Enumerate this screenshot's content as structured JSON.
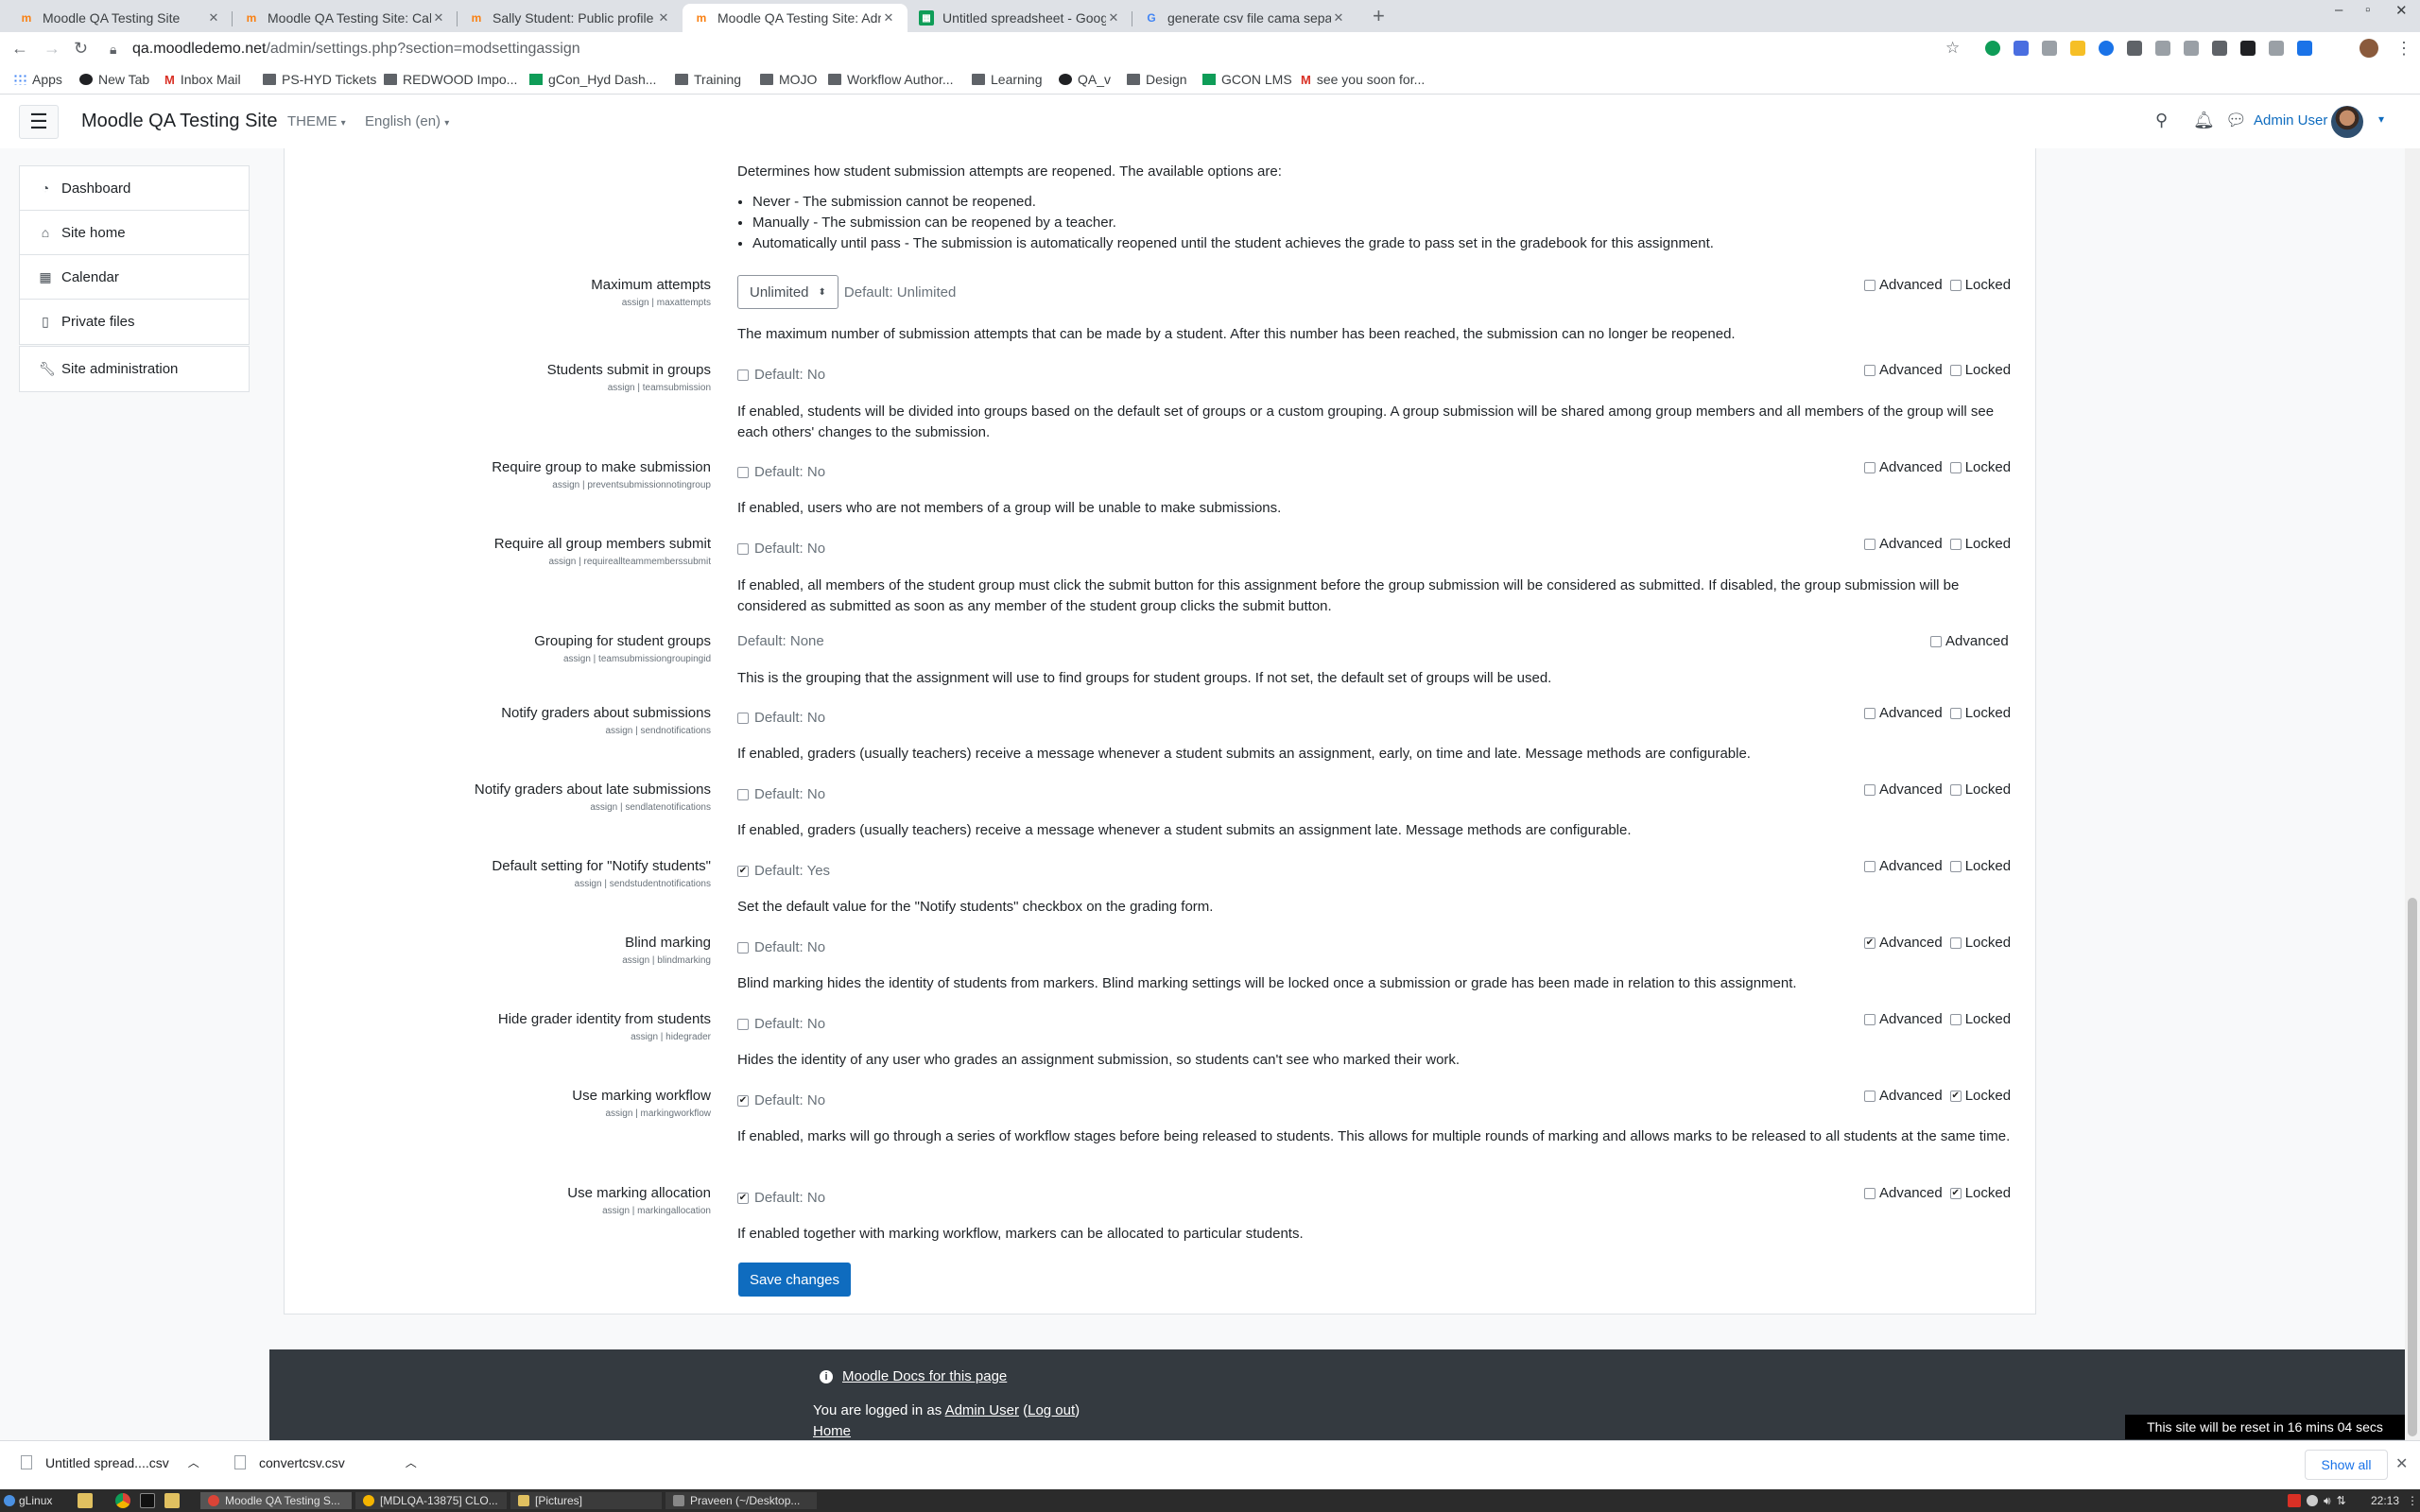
{
  "browser": {
    "tabs": [
      {
        "title": "Moodle QA Testing Site",
        "favicon": "moodle-icon"
      },
      {
        "title": "Moodle QA Testing Site: Calendar",
        "favicon": "moodle-icon"
      },
      {
        "title": "Sally Student: Public profile",
        "favicon": "moodle-icon"
      },
      {
        "title": "Moodle QA Testing Site: Administration",
        "favicon": "moodle-icon",
        "active": true
      },
      {
        "title": "Untitled spreadsheet - Google Sheets",
        "favicon": "sheets-icon"
      },
      {
        "title": "generate csv file cama separated",
        "favicon": "google-icon"
      }
    ],
    "url_host": "qa.moodledemo.net",
    "url_path": "/admin/settings.php?section=modsettingassign",
    "bookmarks": [
      {
        "label": "Apps",
        "icon": "apps-icon"
      },
      {
        "label": "New Tab",
        "icon": "globe-icon"
      },
      {
        "label": "Inbox Mail",
        "icon": "gmail-icon"
      },
      {
        "label": "PS-HYD Tickets",
        "icon": "folder-icon"
      },
      {
        "label": "REDWOOD Impo...",
        "icon": "folder-icon"
      },
      {
        "label": "gCon_Hyd Dash...",
        "icon": "sheets-icon"
      },
      {
        "label": "Training",
        "icon": "folder-icon"
      },
      {
        "label": "MOJO",
        "icon": "folder-icon"
      },
      {
        "label": "Workflow Author...",
        "icon": "folder-icon"
      },
      {
        "label": "Learning",
        "icon": "folder-icon"
      },
      {
        "label": "QA_v",
        "icon": "globe-icon"
      },
      {
        "label": "Design",
        "icon": "folder-icon"
      },
      {
        "label": "GCON LMS",
        "icon": "bookmark-icon"
      },
      {
        "label": "see you soon for...",
        "icon": "gmail-icon"
      }
    ]
  },
  "navbar": {
    "site_name": "Moodle QA Testing Site",
    "theme_menu": "THEME",
    "language_menu": "English (en)",
    "user_name": "Admin User"
  },
  "drawer": {
    "items": [
      {
        "label": "Dashboard",
        "icon": "dashboard-icon"
      },
      {
        "label": "Site home",
        "icon": "home-icon"
      },
      {
        "label": "Calendar",
        "icon": "calendar-icon"
      },
      {
        "label": "Private files",
        "icon": "file-icon"
      }
    ],
    "admin_item": {
      "label": "Site administration",
      "icon": "wrench-icon"
    }
  },
  "settings": {
    "reopen_intro": "Determines how student submission attempts are reopened. The available options are:",
    "reopen_options": [
      "Never - The submission cannot be reopened.",
      "Manually - The submission can be reopened by a teacher.",
      "Automatically until pass - The submission is automatically reopened until the student achieves the grade to pass set in the gradebook for this assignment."
    ],
    "flags": {
      "advanced": "Advanced",
      "locked": "Locked"
    },
    "items": [
      {
        "label": "Maximum attempts",
        "sub": "assign | maxattempts",
        "type": "select",
        "value": "Unlimited",
        "default": "Default: Unlimited",
        "desc": "The maximum number of submission attempts that can be made by a student. After this number has been reached, the submission can no longer be reopened.",
        "advanced": false,
        "locked": false
      },
      {
        "label": "Students submit in groups",
        "sub": "assign | teamsubmission",
        "type": "checkbox",
        "checked": false,
        "default": "Default: No",
        "desc": "If enabled, students will be divided into groups based on the default set of groups or a custom grouping. A group submission will be shared among group members and all members of the group will see each others' changes to the submission.",
        "advanced": false,
        "locked": false
      },
      {
        "label": "Require group to make submission",
        "sub": "assign | preventsubmissionnotingroup",
        "type": "checkbox",
        "checked": false,
        "default": "Default: No",
        "desc": "If enabled, users who are not members of a group will be unable to make submissions.",
        "advanced": false,
        "locked": false
      },
      {
        "label": "Require all group members submit",
        "sub": "assign | requireallteammemberssubmit",
        "type": "checkbox",
        "checked": false,
        "default": "Default: No",
        "desc": "If enabled, all members of the student group must click the submit button for this assignment before the group submission will be considered as submitted. If disabled, the group submission will be considered as submitted as soon as any member of the student group clicks the submit button.",
        "advanced": false,
        "locked": false
      },
      {
        "label": "Grouping for student groups",
        "sub": "assign | teamsubmissiongroupingid",
        "type": "none",
        "default": "Default: None",
        "desc": "This is the grouping that the assignment will use to find groups for student groups. If not set, the default set of groups will be used.",
        "advanced": false
      },
      {
        "label": "Notify graders about submissions",
        "sub": "assign | sendnotifications",
        "type": "checkbox",
        "checked": false,
        "default": "Default: No",
        "desc": "If enabled, graders (usually teachers) receive a message whenever a student submits an assignment, early, on time and late. Message methods are configurable.",
        "advanced": false,
        "locked": false
      },
      {
        "label": "Notify graders about late submissions",
        "sub": "assign | sendlatenotifications",
        "type": "checkbox",
        "checked": false,
        "default": "Default: No",
        "desc": "If enabled, graders (usually teachers) receive a message whenever a student submits an assignment late. Message methods are configurable.",
        "advanced": false,
        "locked": false
      },
      {
        "label": "Default setting for \"Notify students\"",
        "sub": "assign | sendstudentnotifications",
        "type": "checkbox",
        "checked": true,
        "default": "Default: Yes",
        "desc": "Set the default value for the \"Notify students\" checkbox on the grading form.",
        "advanced": false,
        "locked": false
      },
      {
        "label": "Blind marking",
        "sub": "assign | blindmarking",
        "type": "checkbox",
        "checked": false,
        "default": "Default: No",
        "desc": "Blind marking hides the identity of students from markers. Blind marking settings will be locked once a submission or grade has been made in relation to this assignment.",
        "advanced": true,
        "locked": false
      },
      {
        "label": "Hide grader identity from students",
        "sub": "assign | hidegrader",
        "type": "checkbox",
        "checked": false,
        "default": "Default: No",
        "desc": "Hides the identity of any user who grades an assignment submission, so students can't see who marked their work.",
        "advanced": false,
        "locked": false
      },
      {
        "label": "Use marking workflow",
        "sub": "assign | markingworkflow",
        "type": "checkbox",
        "checked": true,
        "default": "Default: No",
        "desc": "If enabled, marks will go through a series of workflow stages before being released to students. This allows for multiple rounds of marking and allows marks to be released to all students at the same time.",
        "advanced": false,
        "locked": true
      },
      {
        "label": "Use marking allocation",
        "sub": "assign | markingallocation",
        "type": "checkbox",
        "checked": true,
        "default": "Default: No",
        "desc": "If enabled together with marking workflow, markers can be allocated to particular students.",
        "advanced": false,
        "locked": true
      }
    ],
    "save_label": "Save changes"
  },
  "footer": {
    "docs_link": "Moodle Docs for this page",
    "logged_prefix": "You are logged in as",
    "user_link": "Admin User",
    "logout_link": "Log out",
    "home_link": "Home",
    "reset_notice": "This site will be reset in 16 mins 04 secs"
  },
  "downloads": {
    "items": [
      {
        "name": "Untitled spread....csv"
      },
      {
        "name": "convertcsv.csv"
      }
    ],
    "show_all": "Show all"
  },
  "taskbar": {
    "start": "gLinux",
    "time": "22:13",
    "windows": [
      {
        "label": "Moodle QA Testing S..."
      },
      {
        "label": "[MDLQA-13875] CLO..."
      },
      {
        "label": "[Pictures]"
      },
      {
        "label": "Praveen (~/Desktop..."
      }
    ]
  }
}
